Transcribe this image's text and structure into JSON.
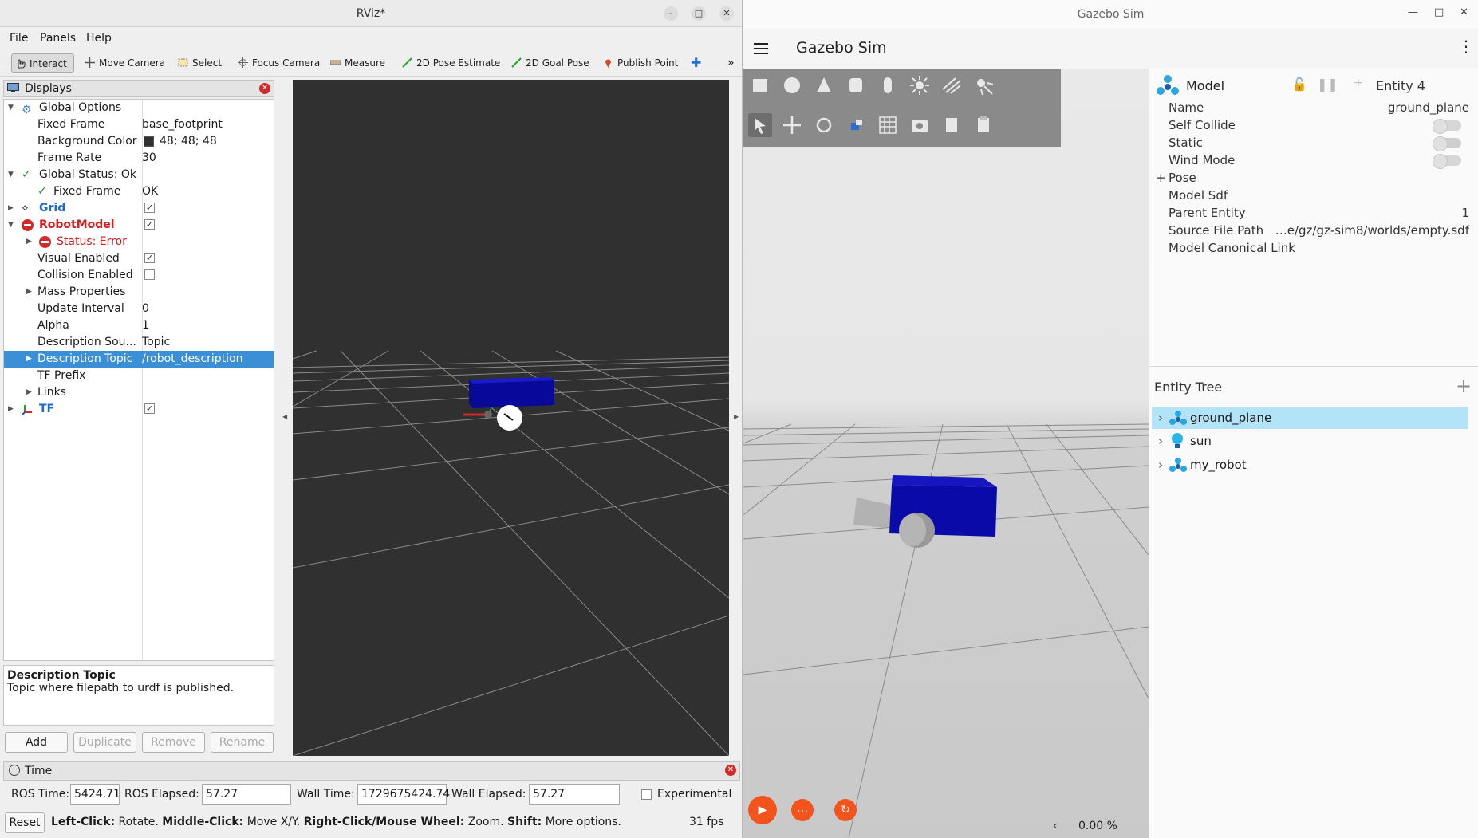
{
  "rviz": {
    "title": "RViz*",
    "menu": [
      "File",
      "Panels",
      "Help"
    ],
    "tools": [
      "Interact",
      "Move Camera",
      "Select",
      "Focus Camera",
      "Measure",
      "2D Pose Estimate",
      "2D Goal Pose",
      "Publish Point"
    ],
    "displays_header": "Displays",
    "tree": [
      {
        "label": "Global Options",
        "value": ""
      },
      {
        "label": "Fixed Frame",
        "value": "base_footprint"
      },
      {
        "label": "Background Color",
        "value": "48; 48; 48"
      },
      {
        "label": "Frame Rate",
        "value": "30"
      },
      {
        "label": "Global Status: Ok",
        "value": ""
      },
      {
        "label": "Fixed Frame",
        "value": "OK"
      },
      {
        "label": "Grid",
        "value": ""
      },
      {
        "label": "RobotModel",
        "value": ""
      },
      {
        "label": "Status: Error",
        "value": ""
      },
      {
        "label": "Visual Enabled",
        "value": ""
      },
      {
        "label": "Collision Enabled",
        "value": ""
      },
      {
        "label": "Mass Properties",
        "value": ""
      },
      {
        "label": "Update Interval",
        "value": "0"
      },
      {
        "label": "Alpha",
        "value": "1"
      },
      {
        "label": "Description Sou...",
        "value": "Topic"
      },
      {
        "label": "Description Topic",
        "value": "/robot_description"
      },
      {
        "label": "TF Prefix",
        "value": ""
      },
      {
        "label": "Links",
        "value": ""
      },
      {
        "label": "TF",
        "value": ""
      }
    ],
    "desc_title": "Description Topic",
    "desc_text": "Topic where filepath to urdf is published.",
    "buttons": [
      "Add",
      "Duplicate",
      "Remove",
      "Rename"
    ],
    "time_header": "Time",
    "ros_time_label": "ROS Time:",
    "ros_time": "5424.71",
    "ros_elapsed_label": "ROS Elapsed:",
    "ros_elapsed": "57.27",
    "wall_time_label": "Wall Time:",
    "wall_time": "1729675424.74",
    "wall_elapsed_label": "Wall Elapsed:",
    "wall_elapsed": "57.27",
    "experimental": "Experimental",
    "reset": "Reset",
    "status_b1": "Left-Click:",
    "status_t1": " Rotate. ",
    "status_b2": "Middle-Click:",
    "status_t2": " Move X/Y. ",
    "status_b3": "Right-Click/Mouse Wheel:",
    "status_t3": " Zoom. ",
    "status_b4": "Shift:",
    "status_t4": " More options.",
    "fps": "31 fps",
    "colors": {
      "background": "#303030",
      "selection": "#3a8fd6",
      "error": "#d12a2a",
      "link": "#1a6bd1"
    }
  },
  "gazebo": {
    "window_title": "Gazebo Sim",
    "app_title": "Gazebo Sim",
    "component_type": "Model",
    "entity_id": "Entity 4",
    "props": [
      {
        "label": "Name",
        "value": "ground_plane"
      },
      {
        "label": "Self Collide",
        "value": ""
      },
      {
        "label": "Static",
        "value": ""
      },
      {
        "label": "Wind Mode",
        "value": ""
      },
      {
        "label": "Pose",
        "value": ""
      },
      {
        "label": "Model Sdf",
        "value": ""
      },
      {
        "label": "Parent Entity",
        "value": "1"
      },
      {
        "label": "Source File Path",
        "value": "…e/gz/gz-sim8/worlds/empty.sdf"
      },
      {
        "label": "Model Canonical Link",
        "value": ""
      }
    ],
    "pose_prefix": "+",
    "entity_tree_title": "Entity Tree",
    "entities": [
      "ground_plane",
      "sun",
      "my_robot"
    ],
    "rtf": "0.00 %",
    "colors": {
      "accent": "#f2541b",
      "selection": "#b3e3f7",
      "robot": "#0a0aa8"
    }
  }
}
